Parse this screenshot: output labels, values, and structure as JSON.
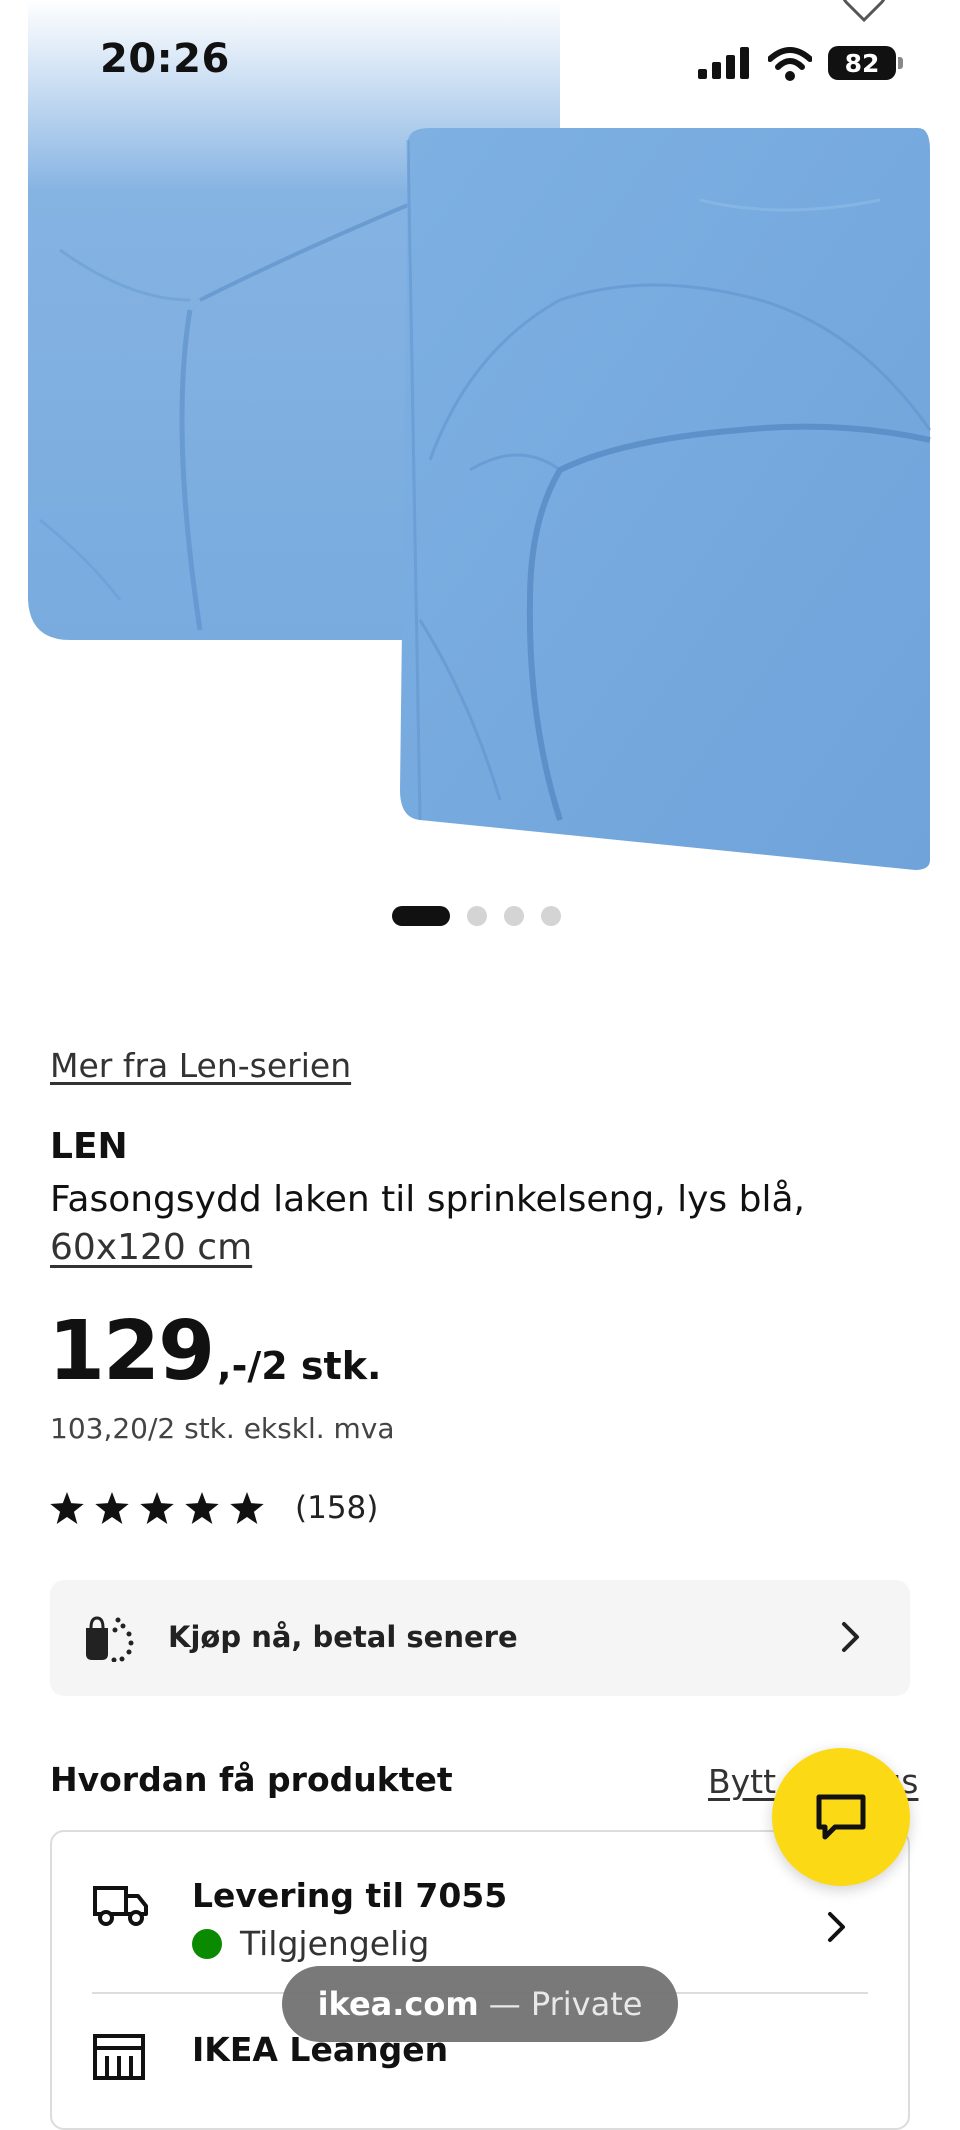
{
  "status_bar": {
    "time": "20:26",
    "battery": "82",
    "icons": [
      "cellular-signal-icon",
      "wifi-icon",
      "battery-icon"
    ]
  },
  "gallery": {
    "image_alt": "Blue fitted crib sheets",
    "dots_total": 4,
    "active_index": 0
  },
  "product": {
    "series_link": "Mer fra Len-serien",
    "name": "LEN",
    "description": "Fasongsydd laken til sprinkelseng, lys blå,",
    "size": "60x120 cm",
    "price_main": "129",
    "price_suffix": ",-/2 stk.",
    "price_ex_vat": "103,20/2 stk. ekskl. mva",
    "rating_stars": 5,
    "rating_count": "(158)"
  },
  "pay_later": {
    "label": "Kjøp nå, betal senere"
  },
  "fulfillment": {
    "title": "Hvordan få produktet",
    "change_link": "Bytt varehus",
    "delivery_title": "Levering til 7055",
    "delivery_status": "Tilgjengelig",
    "store_title": "IKEA Leangen"
  },
  "browser": {
    "domain": "ikea.com",
    "mode": "— Private"
  },
  "colors": {
    "sheet_blue": "#79abdf",
    "available_green": "#0a8a00",
    "chat_yellow": "#fbd914",
    "paylater_bg": "#f5f5f5"
  }
}
